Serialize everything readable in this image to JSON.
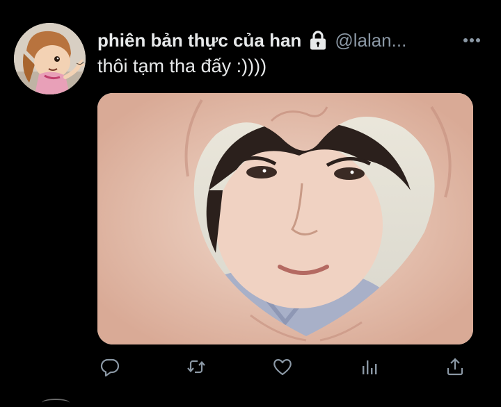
{
  "tweet": {
    "author": {
      "display_name": "phiên bản thực của han",
      "handle": "@lalan...",
      "protected": true,
      "avatar_icon": "cartoon-avatar"
    },
    "text": "thôi tạm tha đấy :))))",
    "media": {
      "type": "photo",
      "icon": "photo"
    },
    "actions": [
      {
        "name": "reply",
        "icon": "speech-bubble-icon"
      },
      {
        "name": "retweet",
        "icon": "retweet-icon"
      },
      {
        "name": "like",
        "icon": "heart-icon"
      },
      {
        "name": "analytics",
        "icon": "bar-chart-icon"
      },
      {
        "name": "share",
        "icon": "share-icon"
      }
    ],
    "more_icon": "ellipsis-icon"
  },
  "colors": {
    "background": "#000000",
    "text_primary": "#e7e9ea",
    "text_secondary": "#8b98a5",
    "icon": "#8b98a5"
  }
}
